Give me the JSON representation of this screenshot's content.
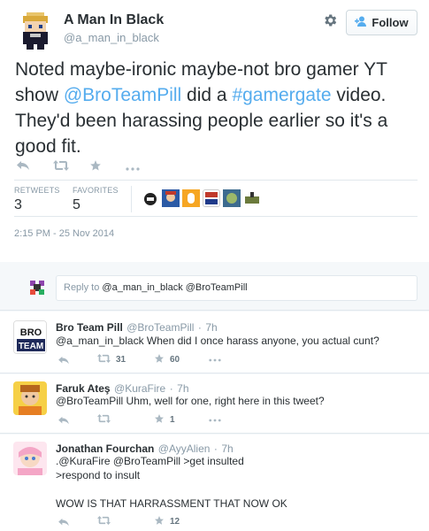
{
  "tweet": {
    "author_name": "A Man In Black",
    "author_handle": "@a_man_in_black",
    "follow_label": "Follow",
    "text_parts": [
      "Noted maybe-ironic maybe-not bro gamer YT show ",
      "@BroTeamPill",
      " did a ",
      "#gamergate",
      " video. They'd been harassing people earlier so it's a good fit."
    ],
    "retweets_label": "RETWEETS",
    "retweets_count": "3",
    "favorites_label": "FAVORITES",
    "favorites_count": "5",
    "timestamp": "2:15 PM - 25 Nov 2014",
    "favorited_by_avatars": [
      "avatar-1",
      "avatar-2",
      "avatar-3",
      "avatar-bro-team",
      "avatar-5",
      "avatar-6"
    ]
  },
  "reply_box": {
    "placeholder_prefix": "Reply to ",
    "placeholder_recipients": "@a_man_in_black @BroTeamPill"
  },
  "replies": [
    {
      "name": "Bro Team Pill",
      "handle": "@BroTeamPill",
      "time": "7h",
      "text": "@a_man_in_black When did I once harass anyone, you actual cunt?",
      "retweets": "31",
      "favorites": "60",
      "avatar_text": "BRO TEAM"
    },
    {
      "name": "Faruk Ateş",
      "handle": "@KuraFire",
      "time": "7h",
      "text": "@BroTeamPill Uhm, well for one, right here in this tweet?",
      "retweets": "",
      "favorites": "1"
    },
    {
      "name": "Jonathan Fourchan",
      "handle": "@AyyAlien",
      "time": "7h",
      "text_lines": [
        ".@KuraFire @BroTeamPill >get insulted",
        ">respond to insult",
        "",
        "WOW IS THAT HARRASSMENT THAT NOW OK"
      ],
      "retweets": "",
      "favorites": "12"
    }
  ],
  "colors": {
    "accent": "#55acee",
    "text": "#292f33",
    "muted": "#8899a6",
    "border": "#e1e8ed",
    "bg_light": "#f5f8fa"
  }
}
